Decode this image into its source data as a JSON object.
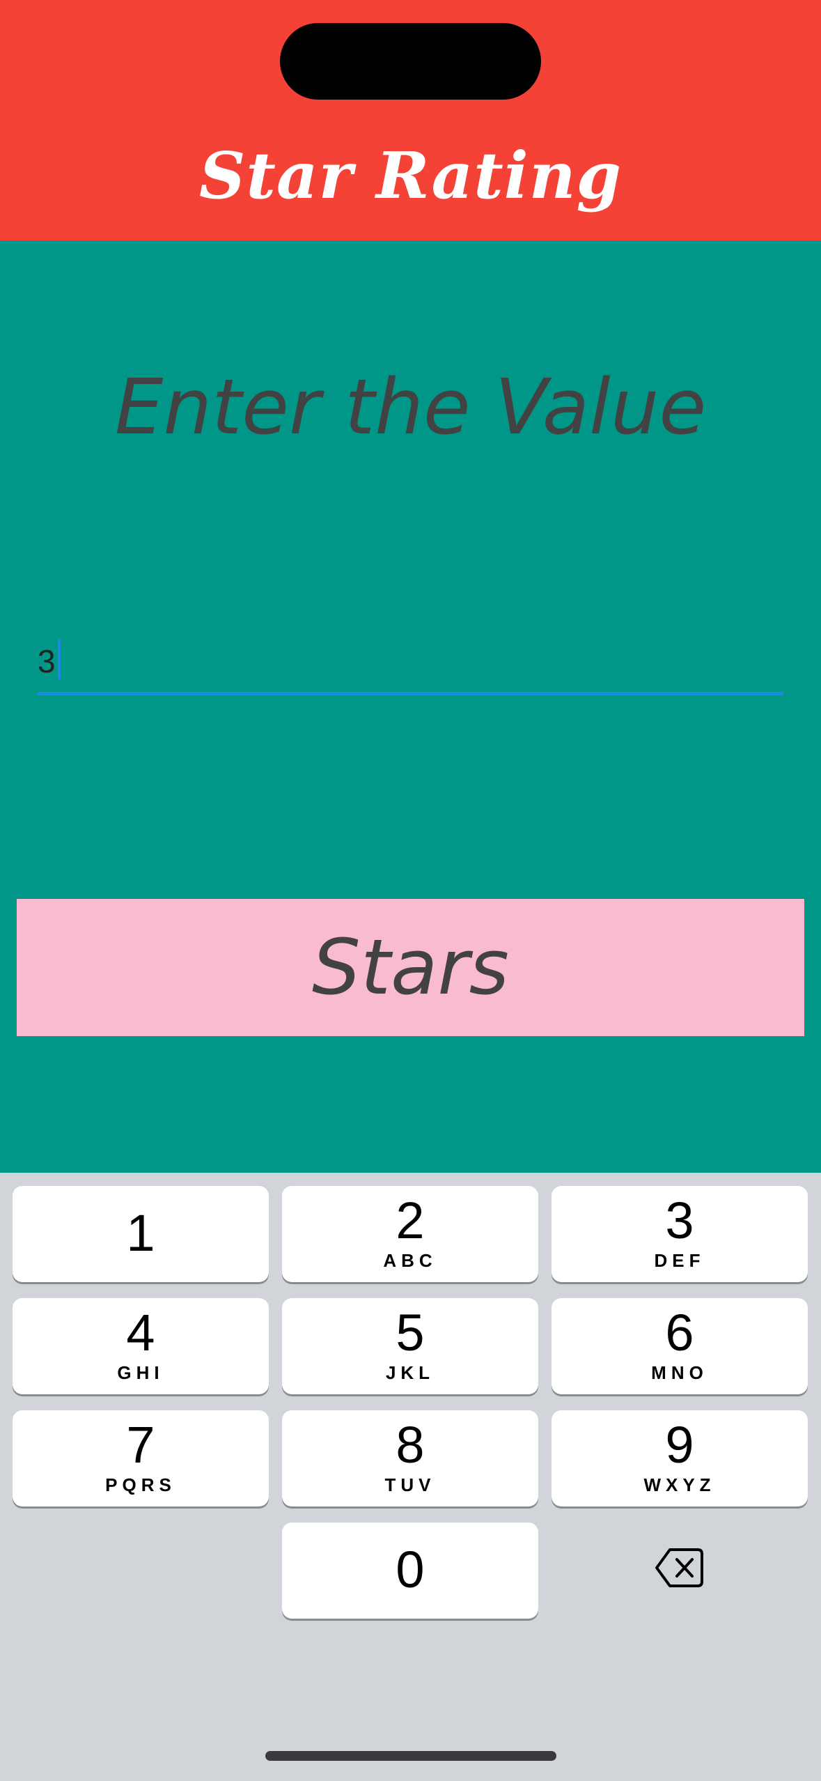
{
  "app_bar": {
    "title": "Star Rating",
    "color": "#f44336"
  },
  "content": {
    "background": "#009688",
    "prompt": "Enter the Value",
    "input": {
      "value": "3"
    },
    "button": {
      "label": "Stars",
      "color": "#f8bbd0"
    }
  },
  "keyboard": {
    "keys": [
      {
        "digit": "1",
        "letters": ""
      },
      {
        "digit": "2",
        "letters": "ABC"
      },
      {
        "digit": "3",
        "letters": "DEF"
      },
      {
        "digit": "4",
        "letters": "GHI"
      },
      {
        "digit": "5",
        "letters": "JKL"
      },
      {
        "digit": "6",
        "letters": "MNO"
      },
      {
        "digit": "7",
        "letters": "PQRS"
      },
      {
        "digit": "8",
        "letters": "TUV"
      },
      {
        "digit": "9",
        "letters": "WXYZ"
      },
      {
        "digit": "0",
        "letters": ""
      }
    ],
    "delete_icon": "backspace-icon"
  }
}
